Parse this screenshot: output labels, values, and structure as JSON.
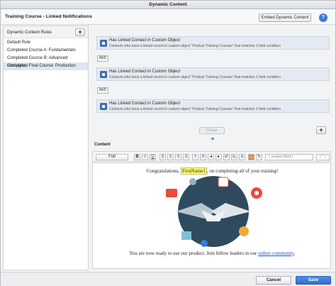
{
  "window": {
    "title": "Dynamic Content"
  },
  "header": {
    "title": "Training Course - Linked Notifications",
    "embed_label": "Embed Dynamic Content",
    "help_glyph": "?"
  },
  "sidebar": {
    "title": "Dynamic Content Rules",
    "add_glyph": "+",
    "items": [
      {
        "label": "Default Rule"
      },
      {
        "label": "Completed Course A: Fundamentals"
      },
      {
        "label": "Completed Course B: Advanced Strategies"
      },
      {
        "label": "Completed Final Course: Production"
      }
    ]
  },
  "conditions": [
    {
      "title": "Has Linked Contact in Custom Object",
      "desc": "Contacts who have a linked record in custom object \"Product Training Courses\" that matches 1 field condition"
    },
    {
      "title": "Has Linked Contact in Custom Object",
      "desc": "Contacts who have a linked record in custom object \"Product Training Courses\" that matches 1 field condition"
    },
    {
      "title": "Has Linked Contact in Custom Object",
      "desc": "Contacts who have a linked record in custom object \"Product Training Courses\" that matches 1 field condition"
    }
  ],
  "and_label": "AND",
  "group_label": "Group",
  "add_condition_glyph": "+",
  "content": {
    "heading": "Content",
    "toolbar": {
      "full_label": "Full",
      "bold": "B",
      "italic": "I",
      "underline": "U",
      "superscript": "x²",
      "subscript": "x₂",
      "clear": "x",
      "font_select": "( unspecified )",
      "size_select": "( * )"
    },
    "greeting_before": "Congratulations,",
    "field_merge": "FirstName1",
    "greeting_after": ", on completing all of your training!",
    "closing_before": "You are now ready to use our product. Join fellow leaders in our",
    "closing_link": "online community",
    "closing_after": "."
  },
  "footer": {
    "cancel_label": "Cancel",
    "save_label": "Save"
  },
  "colors": {
    "accent": "#2c6fd0",
    "condition_bg": "#e4eaf1",
    "selected_rule": "#dde6f3",
    "merge_highlight": "#ffff66"
  },
  "icons": [
    "help-icon",
    "add-icon",
    "condition-icon",
    "gear-icon",
    "handshake-illustration"
  ]
}
